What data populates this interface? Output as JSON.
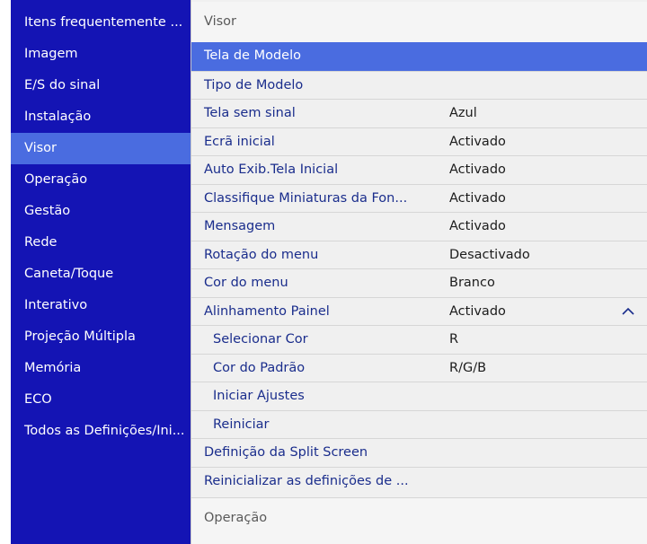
{
  "sidebar": {
    "items": [
      {
        "label": "Itens frequentemente ..."
      },
      {
        "label": "Imagem"
      },
      {
        "label": "E/S do sinal"
      },
      {
        "label": "Instalação"
      },
      {
        "label": "Visor",
        "selected": true
      },
      {
        "label": "Operação"
      },
      {
        "label": "Gestão"
      },
      {
        "label": "Rede"
      },
      {
        "label": "Caneta/Toque"
      },
      {
        "label": "Interativo"
      },
      {
        "label": "Projeção Múltipla"
      },
      {
        "label": "Memória"
      },
      {
        "label": "ECO"
      },
      {
        "label": "Todos as Definições/Ini..."
      }
    ]
  },
  "main": {
    "section_title": "Visor",
    "next_section_title": "Operação",
    "rows": [
      {
        "label": "Tela de Modelo",
        "value": "",
        "selected": true
      },
      {
        "label": "Tipo de Modelo",
        "value": ""
      },
      {
        "label": "Tela sem sinal",
        "value": "Azul"
      },
      {
        "label": "Ecrã inicial",
        "value": "Activado"
      },
      {
        "label": "Auto Exib.Tela Inicial",
        "value": "Activado"
      },
      {
        "label": "Classifique Miniaturas da Fon...",
        "value": "Activado"
      },
      {
        "label": "Mensagem",
        "value": "Activado"
      },
      {
        "label": "Rotação do menu",
        "value": "Desactivado"
      },
      {
        "label": "Cor do menu",
        "value": "Branco"
      },
      {
        "label": "Alinhamento Painel",
        "value": "Activado",
        "expanded": true
      },
      {
        "label": "Selecionar Cor",
        "value": "R",
        "indent": true
      },
      {
        "label": "Cor do Padrão",
        "value": "R/G/B",
        "indent": true
      },
      {
        "label": "Iniciar Ajustes",
        "value": "",
        "indent": true
      },
      {
        "label": "Reiniciar",
        "value": "",
        "indent": true
      },
      {
        "label": "Definição da Split Screen",
        "value": ""
      },
      {
        "label": "Reinicializar as definições de ...",
        "value": ""
      }
    ]
  },
  "icons": {
    "expand": "chevron-up-icon"
  },
  "colors": {
    "sidebar_bg": "#1414b4",
    "selection": "#4a6ce0",
    "label_text": "#1a2d8c",
    "panel_bg": "#f0f0f0"
  }
}
